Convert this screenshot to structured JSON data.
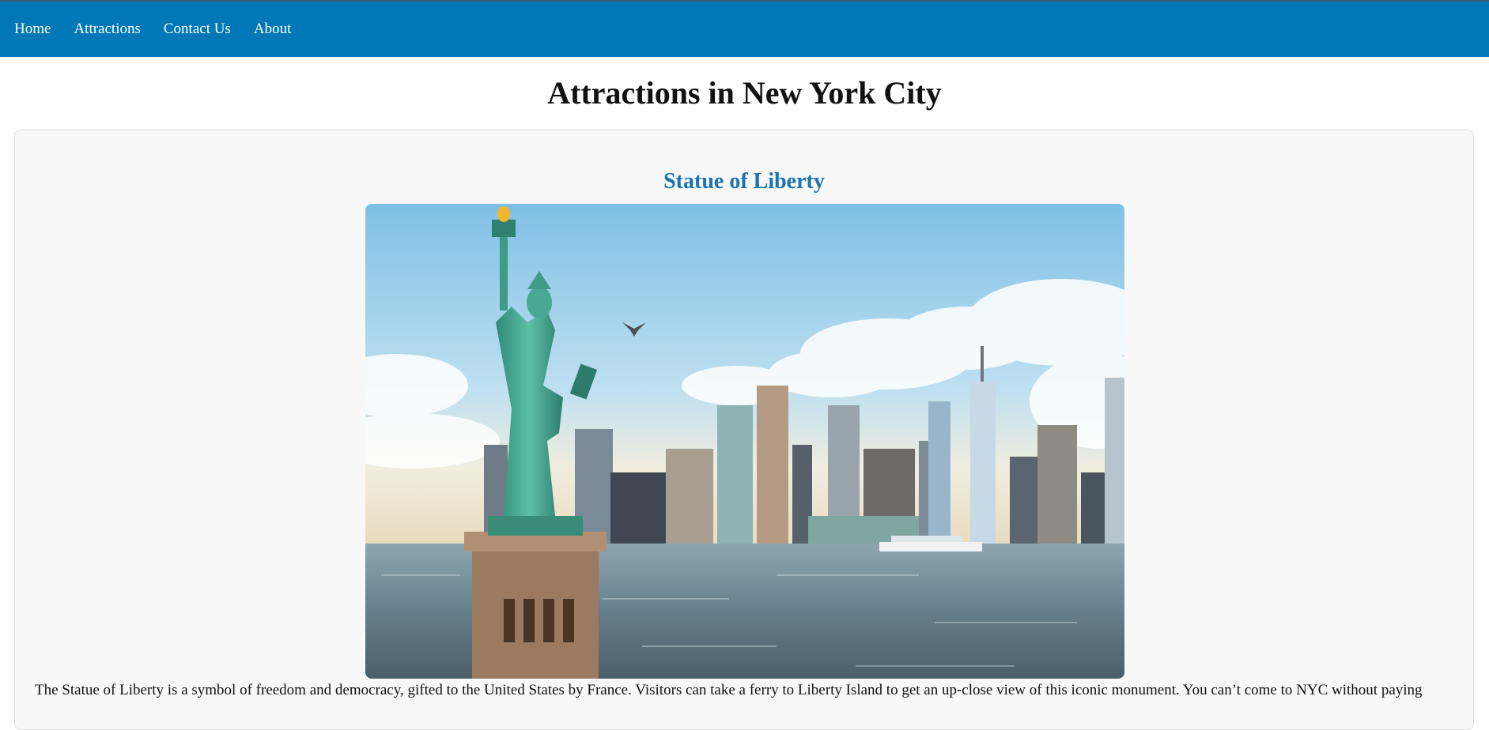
{
  "nav": {
    "items": [
      {
        "label": "Home"
      },
      {
        "label": "Attractions"
      },
      {
        "label": "Contact Us"
      },
      {
        "label": "About"
      }
    ]
  },
  "page": {
    "title": "Attractions in New York City"
  },
  "attractions": [
    {
      "name": "Statue of Liberty",
      "image": "statue-of-liberty-photo",
      "description": "The Statue of Liberty is a symbol of freedom and democracy, gifted to the United States by France. Visitors can take a ferry to Liberty Island to get an up-close view of this iconic monument. You can’t come to NYC without paying"
    }
  ],
  "colors": {
    "header_bg": "#0077b6",
    "accent": "#1a73b4",
    "card_bg": "#f8f8f8"
  }
}
